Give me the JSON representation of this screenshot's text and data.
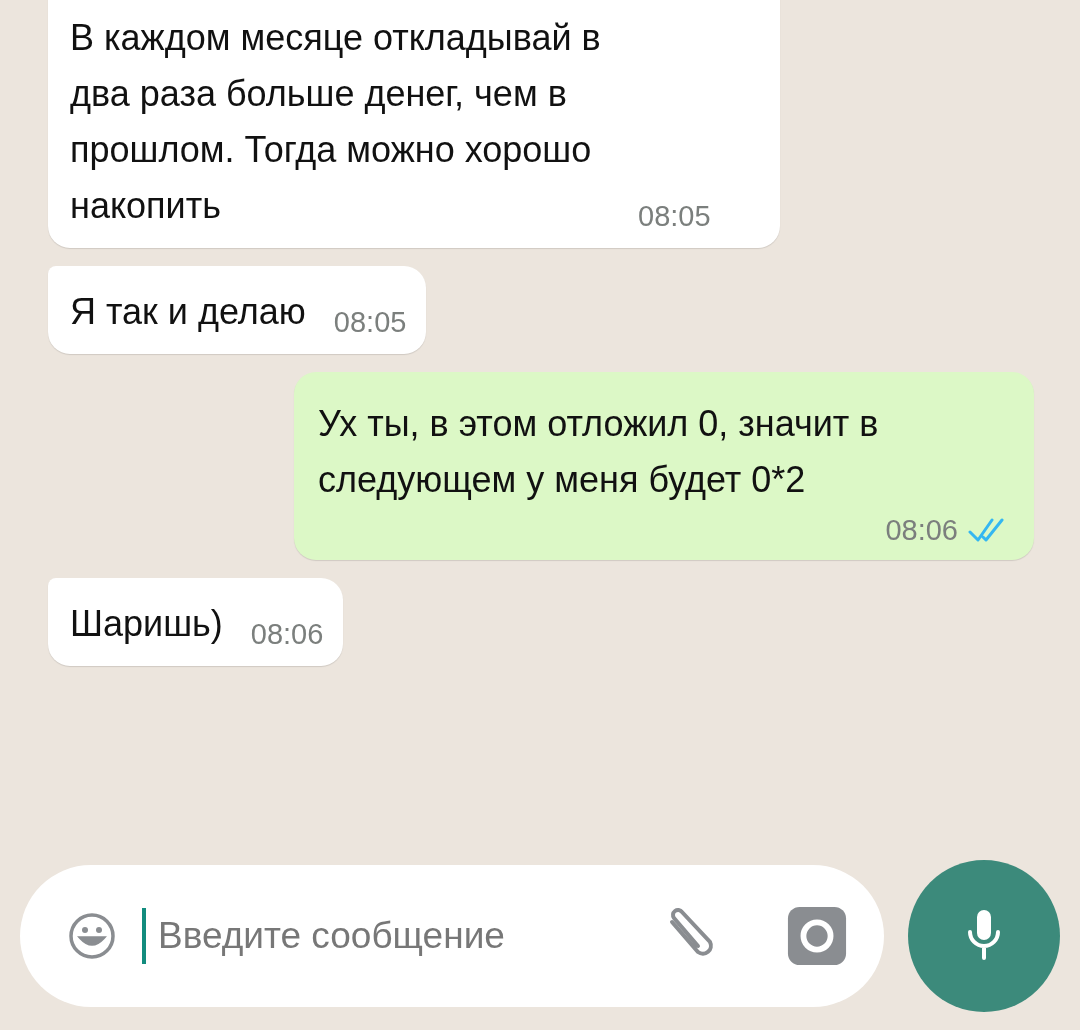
{
  "messages": [
    {
      "kind": "incoming",
      "text": "В каждом месяце откладывай в два раза больше денег, чем в прошлом. Тогда можно хорошо накопить",
      "time": "08:05"
    },
    {
      "kind": "incoming",
      "text": "Я так и делаю",
      "time": "08:05"
    },
    {
      "kind": "outgoing",
      "text": "Ух ты, в этом отложил 0, значит в следующем у меня будет 0*2",
      "time": "08:06",
      "read": true
    },
    {
      "kind": "incoming",
      "text": "Шаришь)",
      "time": "08:06"
    }
  ],
  "composer": {
    "placeholder": "Введите сообщение"
  }
}
